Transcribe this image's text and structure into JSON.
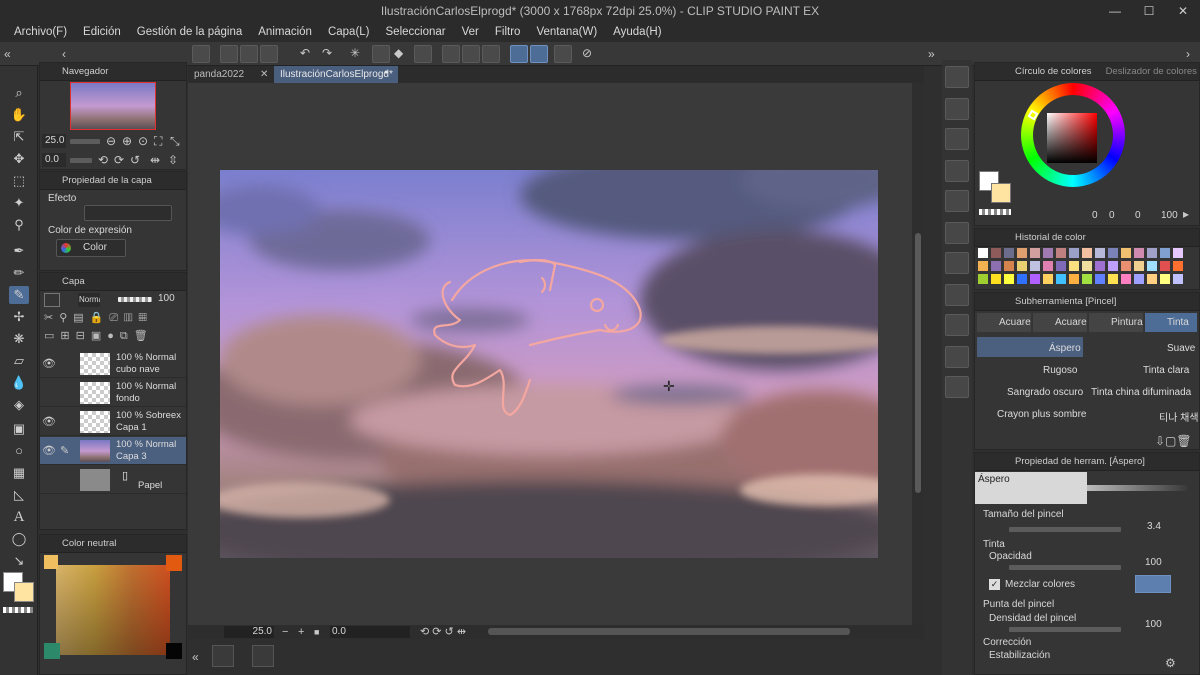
{
  "window": {
    "title": "IlustraciónCarlosElprogd* (3000 x 1768px 72dpi 25.0%) - CLIP STUDIO PAINT EX",
    "minimize": "—",
    "maximize": "☐",
    "close": "✕"
  },
  "menu": [
    "Archivo(F)",
    "Edición",
    "Gestión de la página",
    "Animación",
    "Capa(L)",
    "Seleccionar",
    "Ver",
    "Filtro",
    "Ventana(W)",
    "Ayuda(H)"
  ],
  "tabs": [
    {
      "label": "panda2022",
      "close": "✕"
    },
    {
      "label": "IlustraciónCarlosElprogd*",
      "close": "●"
    }
  ],
  "navigator": {
    "title": "Navegador",
    "zoom": "25.0",
    "rotation": "0.0"
  },
  "layer_property": {
    "title": "Propiedad de la capa",
    "effect_label": "Efecto",
    "expression_color_label": "Color de expresión",
    "expression_color_value": "Color"
  },
  "layers": {
    "title": "Capa",
    "blend_mode": "Normal",
    "opacity": "100",
    "items": [
      {
        "percent": "100 %",
        "mode": "Normal",
        "name": "cubo nave",
        "visible": true,
        "selected": false
      },
      {
        "percent": "100 %",
        "mode": "Normal",
        "name": "fondo",
        "visible": false,
        "selected": false
      },
      {
        "percent": "100 %",
        "mode": "Sobreex",
        "name": "Capa 1",
        "visible": true,
        "selected": false
      },
      {
        "percent": "100 %",
        "mode": "Normal",
        "name": "Capa 3",
        "visible": true,
        "selected": true
      },
      {
        "percent": "",
        "mode": "",
        "name": "Papel",
        "visible": false,
        "selected": false
      }
    ]
  },
  "color_set": {
    "title": "Color neutral"
  },
  "canvas": {
    "zoom": "25.0",
    "angle": "0.0"
  },
  "color_wheel": {
    "tab1": "Círculo de colores",
    "tab2": "Deslizador de colores",
    "h": "0",
    "s": "0",
    "v": "100",
    "extra": "0"
  },
  "color_history": {
    "title": "Historial de color",
    "colors": [
      "#ffffff",
      "#8f5a5a",
      "#6c6c8c",
      "#e0a070",
      "#d3a0a0",
      "#a07ab0",
      "#c08080",
      "#9aa0c8",
      "#f2c0a0",
      "#b8b8d8",
      "#7b82b8",
      "#f0c070",
      "#d08ab0",
      "#a0a0c8",
      "#7fa0d0",
      "#e7c7ff",
      "#f3b14f",
      "#8c6fb0",
      "#d6844e",
      "#e9d070",
      "#c0c0e0",
      "#e080b0",
      "#7e6ab8",
      "#ffe080",
      "#f0e0a0",
      "#a070d0",
      "#c0a0ff",
      "#e89070",
      "#f0d090",
      "#a0e0ff",
      "#e05050",
      "#ff7030",
      "#a0d030",
      "#ffe020",
      "#ffff40",
      "#3070ff",
      "#b060ff",
      "#ffd060",
      "#40c0ff",
      "#ffb040",
      "#a0e040",
      "#6080ff",
      "#ffe050",
      "#ff80c0",
      "#a0a0ff",
      "#ffd080",
      "#ffff80",
      "#c0c0ff"
    ]
  },
  "subtool": {
    "title": "Subherramienta [Pincel]",
    "tabs": [
      "Acuare",
      "Acuare",
      "Pintura",
      "Tinta"
    ],
    "brushes": [
      "Áspero",
      "Suave",
      "Rugoso",
      "Tinta clara",
      "Sangrado oscuro",
      "Tinta china difuminada",
      "Crayon plus sombre",
      "티나 채색"
    ]
  },
  "tool_property": {
    "title": "Propiedad de herram. [Áspero]",
    "preview_name": "Áspero",
    "brush_size_label": "Tamaño del pincel",
    "brush_size": "3.4",
    "ink_label": "Tinta",
    "opacity_label": "Opacidad",
    "opacity": "100",
    "mix_label": "Mezclar colores",
    "tip_label": "Punta del pincel",
    "density_label": "Densidad del pincel",
    "density": "100",
    "correction_label": "Corrección",
    "stabilization_label": "Estabilización"
  },
  "colors": {
    "accent": "#4d6c96",
    "main_color": "#ffffff",
    "sub_color": "#ffe3a0",
    "stroke": "#f4a7a0"
  }
}
